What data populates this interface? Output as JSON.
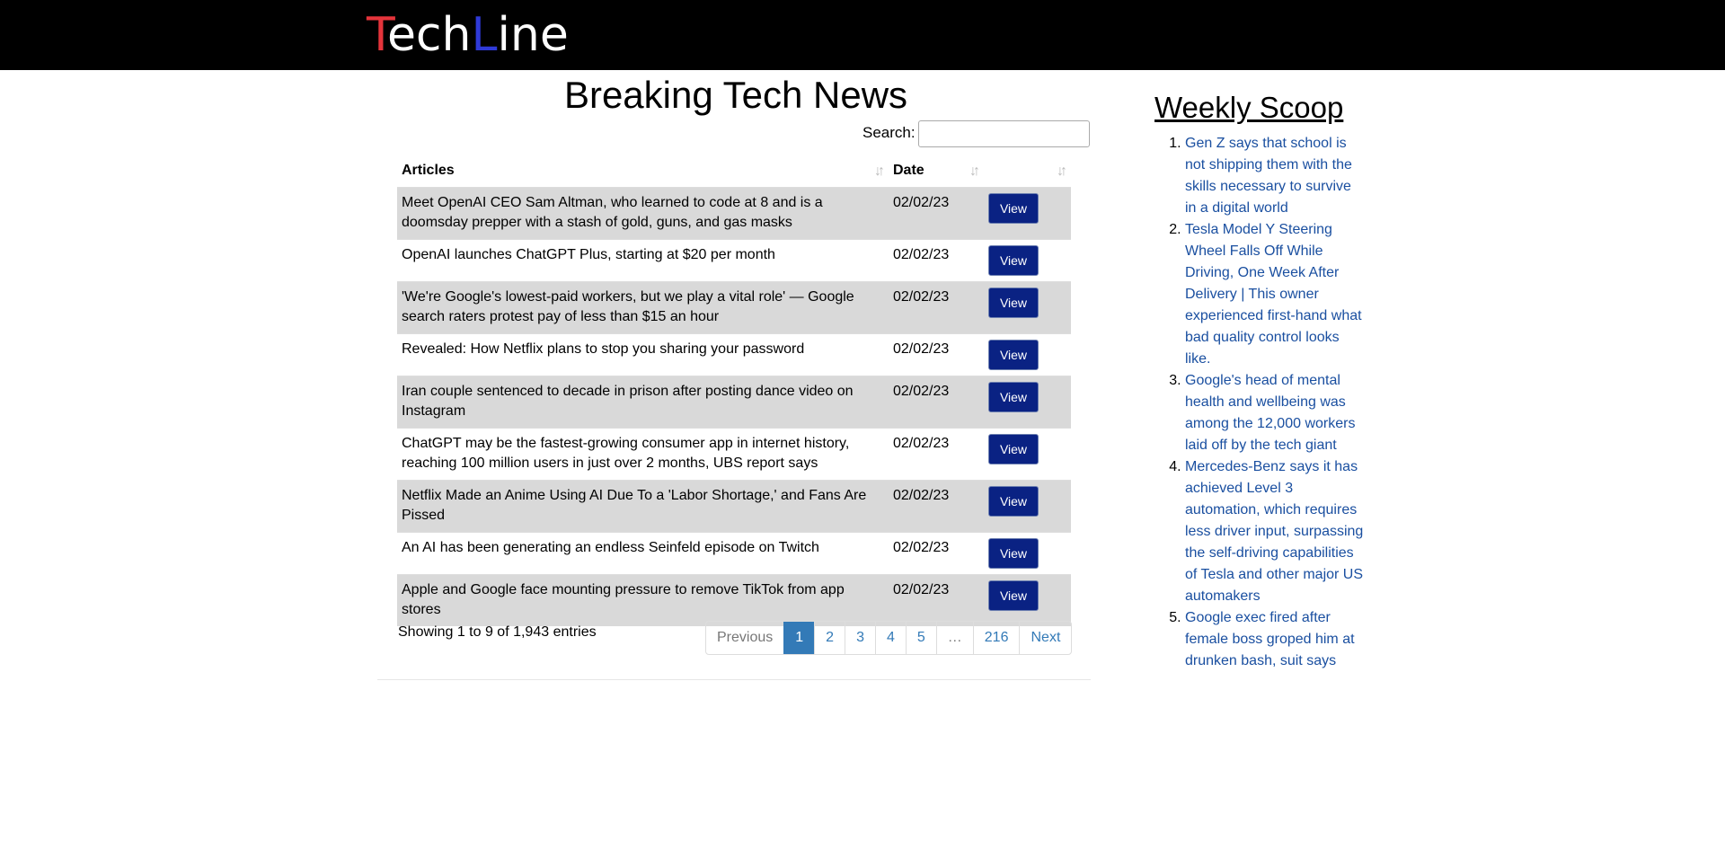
{
  "header": {
    "logo_t": "T",
    "logo_ech": "ech",
    "logo_l": "L",
    "logo_ine": "ine",
    "colors": {
      "background": "#000000",
      "logo_red": "#e5343b",
      "logo_blue": "#2f3ad8"
    }
  },
  "main": {
    "title": "Breaking Tech News",
    "search_label": "Search:",
    "search_value": "",
    "columns": [
      "Articles",
      "Date",
      ""
    ],
    "rows": [
      {
        "article": "Meet OpenAI CEO Sam Altman, who learned to code at 8 and is a doomsday prepper with a stash of gold, guns, and gas masks",
        "date": "02/02/23",
        "action": "View"
      },
      {
        "article": "OpenAI launches ChatGPT Plus, starting at $20 per month",
        "date": "02/02/23",
        "action": "View"
      },
      {
        "article": "'We're Google's lowest-paid workers, but we play a vital role' — Google search raters protest pay of less than $15 an hour",
        "date": "02/02/23",
        "action": "View"
      },
      {
        "article": "Revealed: How Netflix plans to stop you sharing your password",
        "date": "02/02/23",
        "action": "View"
      },
      {
        "article": "Iran couple sentenced to decade in prison after posting dance video on Instagram",
        "date": "02/02/23",
        "action": "View"
      },
      {
        "article": "ChatGPT may be the fastest-growing consumer app in internet history, reaching 100 million users in just over 2 months, UBS report says",
        "date": "02/02/23",
        "action": "View"
      },
      {
        "article": "Netflix Made an Anime Using AI Due To a 'Labor Shortage,' and Fans Are Pissed",
        "date": "02/02/23",
        "action": "View"
      },
      {
        "article": "An AI has been generating an endless Seinfeld episode on Twitch",
        "date": "02/02/23",
        "action": "View"
      },
      {
        "article": "Apple and Google face mounting pressure to remove TikTok from app stores",
        "date": "02/02/23",
        "action": "View"
      }
    ],
    "info": "Showing 1 to 9 of 1,943 entries",
    "pagination": {
      "previous": "Previous",
      "pages": [
        "1",
        "2",
        "3",
        "4",
        "5"
      ],
      "ellipsis": "…",
      "last": "216",
      "next": "Next",
      "active": "1"
    },
    "sort_icon": "sort-arrows-icon"
  },
  "sidebar": {
    "title": "Weekly Scoop",
    "items": [
      "Gen Z says that school is not shipping them with the skills necessary to survive in a digital world",
      "Tesla Model Y Steering Wheel Falls Off While Driving, One Week After Delivery | This owner experienced first-hand what bad quality control looks like.",
      "Google's head of mental health and wellbeing was among the 12,000 workers laid off by the tech giant",
      "Mercedes-Benz says it has achieved Level 3 automation, which requires less driver input, surpassing the self-driving capabilities of Tesla and other major US automakers",
      "Google exec fired after female boss groped him at drunken bash, suit says"
    ],
    "link_color": "#1a4fa0"
  }
}
